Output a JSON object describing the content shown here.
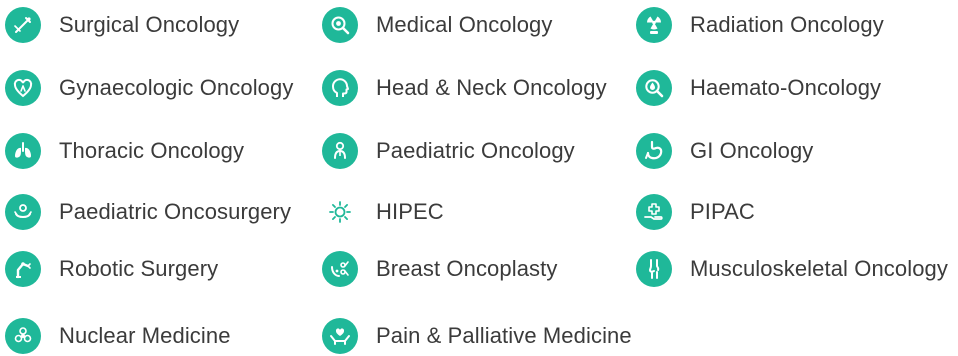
{
  "accent_color": "#1fb899",
  "specialties": {
    "col1": [
      {
        "label": "Surgical Oncology",
        "icon": "scalpel-icon"
      },
      {
        "label": "Gynaecologic Oncology",
        "icon": "heart-ribbon-icon"
      },
      {
        "label": "Thoracic Oncology",
        "icon": "lungs-icon"
      },
      {
        "label": "Paediatric Oncosurgery",
        "icon": "baby-hands-icon"
      },
      {
        "label": "Robotic Surgery",
        "icon": "robotic-arm-icon"
      },
      {
        "label": "Nuclear Medicine",
        "icon": "radiation-flower-icon"
      }
    ],
    "col2": [
      {
        "label": "Medical Oncology",
        "icon": "magnifier-cell-icon"
      },
      {
        "label": "Head & Neck Oncology",
        "icon": "head-profile-icon"
      },
      {
        "label": "Paediatric Oncology",
        "icon": "child-icon"
      },
      {
        "label": "HIPEC",
        "icon": "sun-icon"
      },
      {
        "label": "Breast Oncoplasty",
        "icon": "breast-scissors-icon"
      },
      {
        "label": "Pain & Palliative Medicine",
        "icon": "care-hands-icon"
      }
    ],
    "col3": [
      {
        "label": "Radiation Oncology",
        "icon": "radiation-icon"
      },
      {
        "label": "Haemato-Oncology",
        "icon": "blood-drop-magnifier-icon"
      },
      {
        "label": "GI Oncology",
        "icon": "stomach-icon"
      },
      {
        "label": "PIPAC",
        "icon": "medical-cross-hand-icon"
      },
      {
        "label": "Musculoskeletal Oncology",
        "icon": "knee-joint-icon"
      }
    ]
  }
}
